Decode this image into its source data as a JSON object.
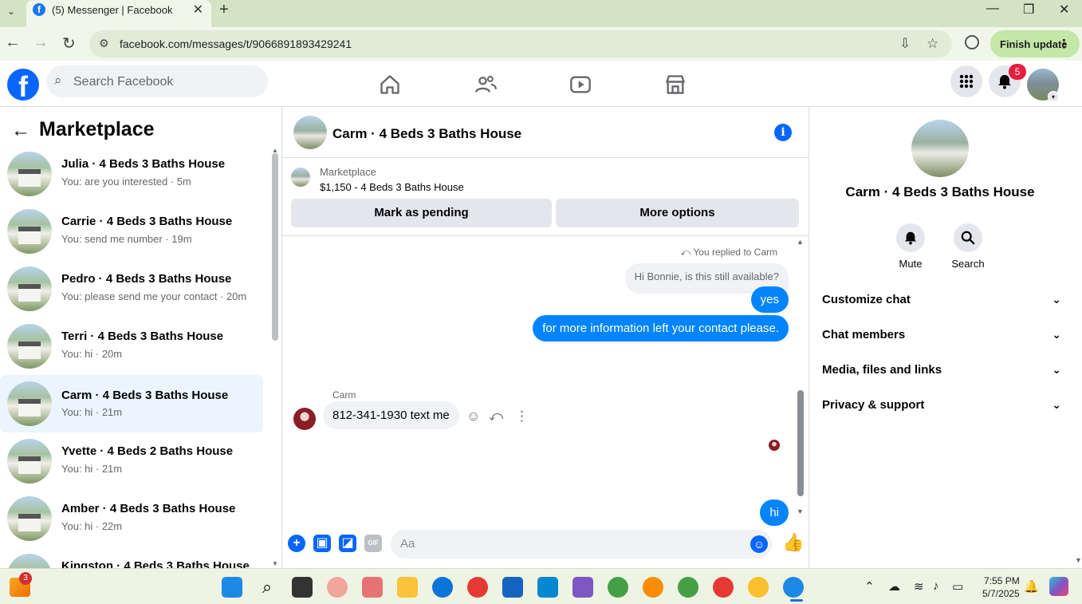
{
  "browser": {
    "tab_title": "(5) Messenger | Facebook",
    "tab_favicon": "f",
    "url": "facebook.com/messages/t/9066891893429241",
    "finish_update_label": "Finish update"
  },
  "header": {
    "logo": "f",
    "search_placeholder": "Search Facebook",
    "notification_count": "5"
  },
  "sidebar": {
    "title": "Marketplace",
    "conversations": [
      {
        "name": "Julia · 4 Beds 3 Baths House",
        "preview": "You: are you interested · 5m",
        "active": false
      },
      {
        "name": "Carrie · 4 Beds 3 Baths House",
        "preview": "You: send me number · 19m",
        "active": false
      },
      {
        "name": "Pedro · 4 Beds 3 Baths House",
        "preview": "You: please send me your contact · 20m",
        "active": false
      },
      {
        "name": "Terri · 4 Beds 3 Baths House",
        "preview": "You: hi · 20m",
        "active": false
      },
      {
        "name": "Carm · 4 Beds 3 Baths House",
        "preview": "You: hi · 21m",
        "active": true
      },
      {
        "name": "Yvette · 4 Beds 2 Baths House",
        "preview": "You: hi · 21m",
        "active": false
      },
      {
        "name": "Amber · 4 Beds 3 Baths House",
        "preview": "You: hi · 22m",
        "active": false
      },
      {
        "name": "Kingston · 4 Beds 3 Baths House",
        "preview": "",
        "active": false
      }
    ]
  },
  "chat": {
    "title": "Carm · 4 Beds 3 Baths House",
    "listing": {
      "label": "Marketplace",
      "price_title": "$1,150 - 4 Beds 3 Baths House",
      "mark_pending_label": "Mark as pending",
      "more_options_label": "More options"
    },
    "replied_note": "You replied to Carm",
    "quoted_message": "Hi Bonnie, is this still available?",
    "outgoing_1": "yes",
    "outgoing_2": "for more information left your contact please.",
    "incoming_sender": "Carm",
    "incoming_message": "812-341-1930 text me",
    "outgoing_3": "hi",
    "composer_placeholder": "Aa"
  },
  "details": {
    "name": "Carm · 4 Beds 3 Baths House",
    "mute_label": "Mute",
    "search_label": "Search",
    "sections": [
      "Customize chat",
      "Chat members",
      "Media, files and links",
      "Privacy & support"
    ]
  },
  "taskbar": {
    "weather_badge": "3",
    "time": "7:55 PM",
    "date": "5/7/2025"
  },
  "colors": {
    "fb_blue": "#0866ff",
    "messenger_blue": "#0084ff",
    "active_row": "#ebf5ff",
    "notification_red": "#e41e3f"
  }
}
